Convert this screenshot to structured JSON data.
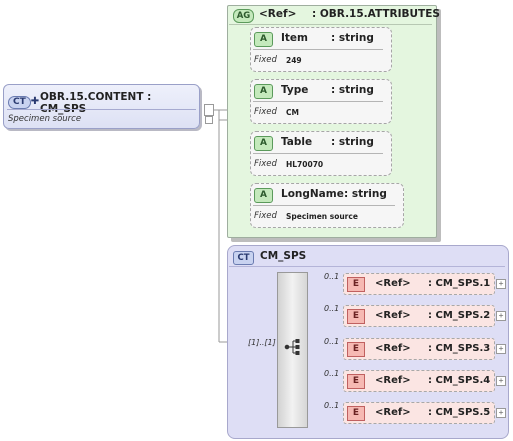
{
  "main": {
    "badge": "CT",
    "title": "OBR.15.CONTENT : CM_SPS",
    "description": "Specimen source"
  },
  "attributes_group": {
    "badge": "AG",
    "ref": "<Ref>",
    "name": ": OBR.15.ATTRIBUTES",
    "items": [
      {
        "badge": "A",
        "name": "Item",
        "type": ": string",
        "fixed_label": "Fixed",
        "fixed_value": "249"
      },
      {
        "badge": "A",
        "name": "Type",
        "type": ": string",
        "fixed_label": "Fixed",
        "fixed_value": "CM"
      },
      {
        "badge": "A",
        "name": "Table",
        "type": ": string",
        "fixed_label": "Fixed",
        "fixed_value": "HL70070"
      },
      {
        "badge": "A",
        "name": "LongName",
        "type": ": string",
        "fixed_label": "Fixed",
        "fixed_value": "Specimen source"
      }
    ]
  },
  "complex_type": {
    "badge": "CT",
    "name": "CM_SPS",
    "occurrence": "[1]..[1]",
    "elements": [
      {
        "occurrence": "0..1",
        "badge": "E",
        "ref": "<Ref>",
        "name": ": CM_SPS.1",
        "expand": "+"
      },
      {
        "occurrence": "0..1",
        "badge": "E",
        "ref": "<Ref>",
        "name": ": CM_SPS.2",
        "expand": "+"
      },
      {
        "occurrence": "0..1",
        "badge": "E",
        "ref": "<Ref>",
        "name": ": CM_SPS.3",
        "expand": "+"
      },
      {
        "occurrence": "0..1",
        "badge": "E",
        "ref": "<Ref>",
        "name": ": CM_SPS.4",
        "expand": "+"
      },
      {
        "occurrence": "0..1",
        "badge": "E",
        "ref": "<Ref>",
        "name": ": CM_SPS.5",
        "expand": "+"
      }
    ]
  }
}
